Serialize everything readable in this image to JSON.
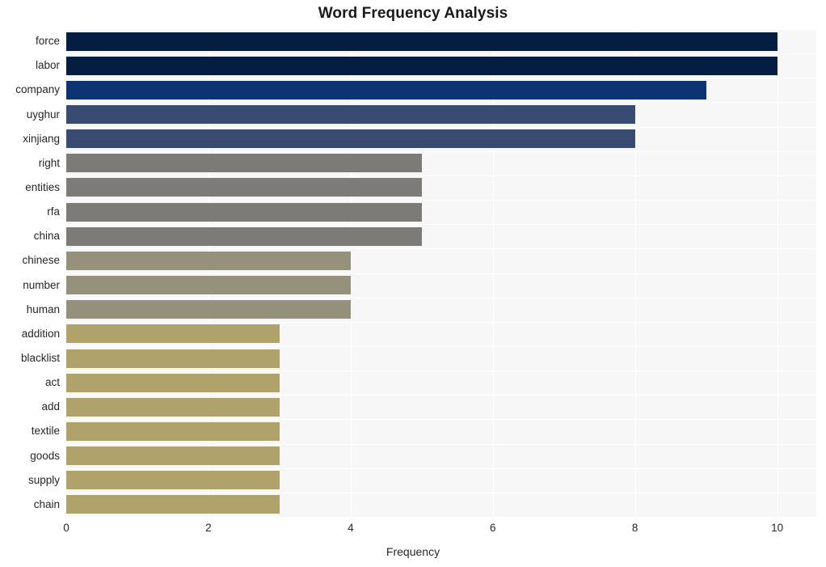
{
  "chart_data": {
    "type": "bar",
    "orientation": "horizontal",
    "title": "Word Frequency Analysis",
    "xlabel": "Frequency",
    "ylabel": "",
    "xlim": [
      0,
      10.55
    ],
    "xticks": [
      0,
      2,
      4,
      6,
      8,
      10
    ],
    "xtick_labels": [
      "0",
      "2",
      "4",
      "6",
      "8",
      "10"
    ],
    "grid": true,
    "legend": null,
    "categories": [
      "force",
      "labor",
      "company",
      "uyghur",
      "xinjiang",
      "right",
      "entities",
      "rfa",
      "china",
      "chinese",
      "number",
      "human",
      "addition",
      "blacklist",
      "act",
      "add",
      "textile",
      "goods",
      "supply",
      "chain"
    ],
    "values": [
      10,
      10,
      9,
      8,
      8,
      5,
      5,
      5,
      5,
      4,
      4,
      4,
      3,
      3,
      3,
      3,
      3,
      3,
      3,
      3
    ],
    "bar_colors": [
      "#041E42",
      "#041E42",
      "#0C3372",
      "#384B72",
      "#3A4B72",
      "#7C7B78",
      "#7C7B78",
      "#7C7B78",
      "#7C7B78",
      "#96917A",
      "#96917A",
      "#94907C",
      "#AFA26B",
      "#AFA26B",
      "#AFA26B",
      "#AFA26B",
      "#AFA26B",
      "#AFA26B",
      "#AFA26B",
      "#AFA26B"
    ],
    "plot_background": "#f7f7f7",
    "figure_background": "#ffffff",
    "grid_color": "#ffffff"
  }
}
